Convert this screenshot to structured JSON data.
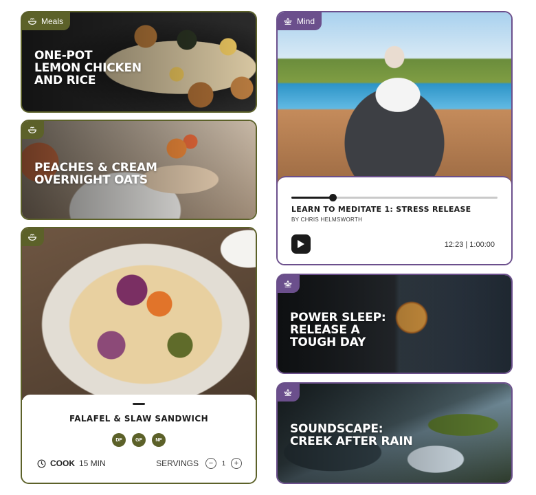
{
  "meals": {
    "cards": [
      {
        "tag_label": "Meals",
        "title_line1": "ONE-POT",
        "title_line2": "LEMON CHICKEN",
        "title_line3": "AND RICE"
      },
      {
        "title_line1": "PEACHES & CREAM",
        "title_line2": "OVERNIGHT OATS"
      }
    ],
    "featured": {
      "title": "FALAFEL & SLAW SANDWICH",
      "badges": [
        "DF",
        "GF",
        "NF"
      ],
      "cook_label": "COOK",
      "cook_time": "15 MIN",
      "servings_label": "SERVINGS",
      "servings_value": "1",
      "decrement_symbol": "−",
      "increment_symbol": "+"
    }
  },
  "mind": {
    "tag_label": "Mind",
    "player": {
      "title": "LEARN TO MEDITATE 1: STRESS RELEASE",
      "author": "BY CHRIS HELMSWORTH",
      "time": "12:23 | 1:00:00",
      "progress": 0.2
    },
    "cards": [
      {
        "title_line1": "POWER SLEEP:",
        "title_line2": "RELEASE A",
        "title_line3": "TOUGH DAY"
      },
      {
        "title_line1": "SOUNDSCAPE:",
        "title_line2": "CREEK AFTER RAIN"
      }
    ]
  },
  "colors": {
    "meals_accent": "#5c6129",
    "mind_accent": "#6b4f8c"
  },
  "icons": {
    "meals": "bowl-icon",
    "mind": "lotus-icon",
    "play": "play-icon",
    "clock": "clock-icon"
  }
}
